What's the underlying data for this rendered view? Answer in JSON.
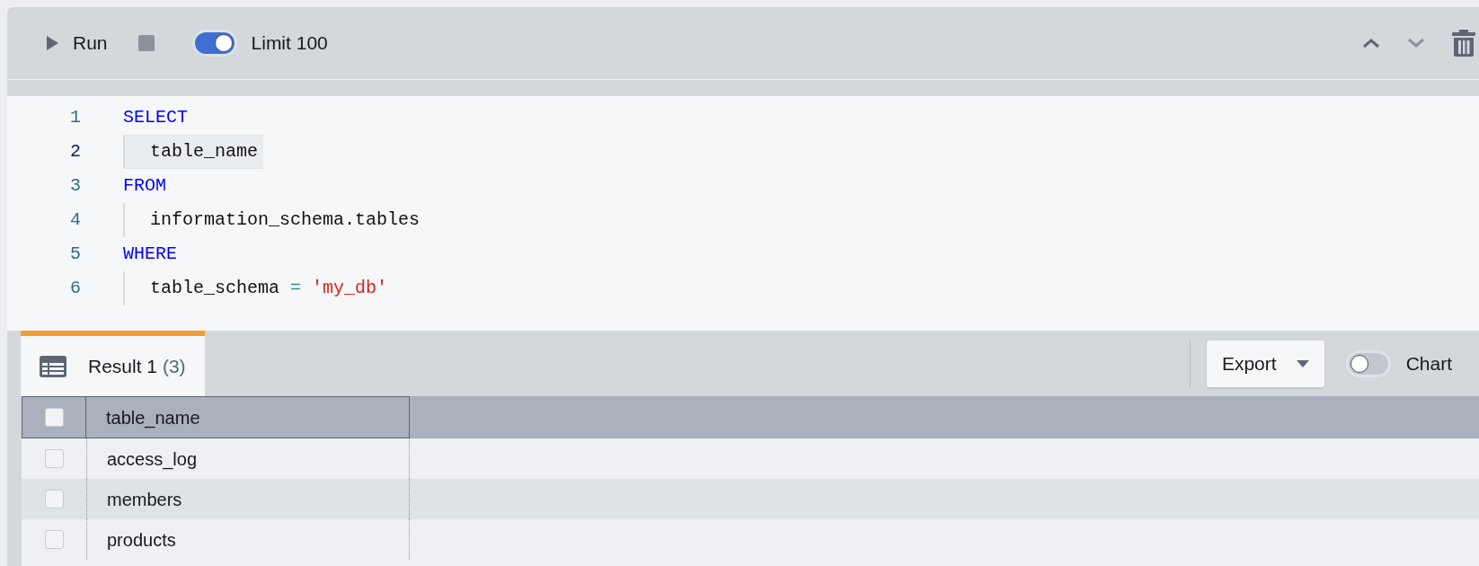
{
  "toolbar": {
    "run_label": "Run",
    "limit": {
      "label": "Limit 100",
      "on": true
    },
    "move_up_disabled": false,
    "move_down_disabled": true
  },
  "editor": {
    "lines": [
      {
        "number": "1",
        "current": false,
        "indented": false,
        "tokens": [
          {
            "kind": "keyword",
            "text": "SELECT"
          }
        ]
      },
      {
        "number": "2",
        "current": true,
        "indented": true,
        "tokens": [
          {
            "kind": "plain",
            "text": "table_name"
          }
        ]
      },
      {
        "number": "3",
        "current": false,
        "indented": false,
        "tokens": [
          {
            "kind": "keyword",
            "text": "FROM"
          }
        ]
      },
      {
        "number": "4",
        "current": false,
        "indented": true,
        "tokens": [
          {
            "kind": "plain",
            "text": "information_schema.tables"
          }
        ]
      },
      {
        "number": "5",
        "current": false,
        "indented": false,
        "tokens": [
          {
            "kind": "keyword",
            "text": "WHERE"
          }
        ]
      },
      {
        "number": "6",
        "current": false,
        "indented": true,
        "tokens": [
          {
            "kind": "plain",
            "text": "table_schema "
          },
          {
            "kind": "operator",
            "text": "= "
          },
          {
            "kind": "string",
            "text": "'my_db'"
          }
        ]
      }
    ]
  },
  "results": {
    "tabs": [
      {
        "label": "Result 1",
        "count": "(3)",
        "selected": true
      }
    ],
    "export_label": "Export",
    "chart": {
      "label": "Chart",
      "on": false
    },
    "table": {
      "select_all_checked": false,
      "columns": [
        "table_name"
      ],
      "rows": [
        {
          "checked": false,
          "cells": [
            "access_log"
          ]
        },
        {
          "checked": false,
          "cells": [
            "members"
          ]
        },
        {
          "checked": false,
          "cells": [
            "products"
          ]
        }
      ]
    }
  }
}
